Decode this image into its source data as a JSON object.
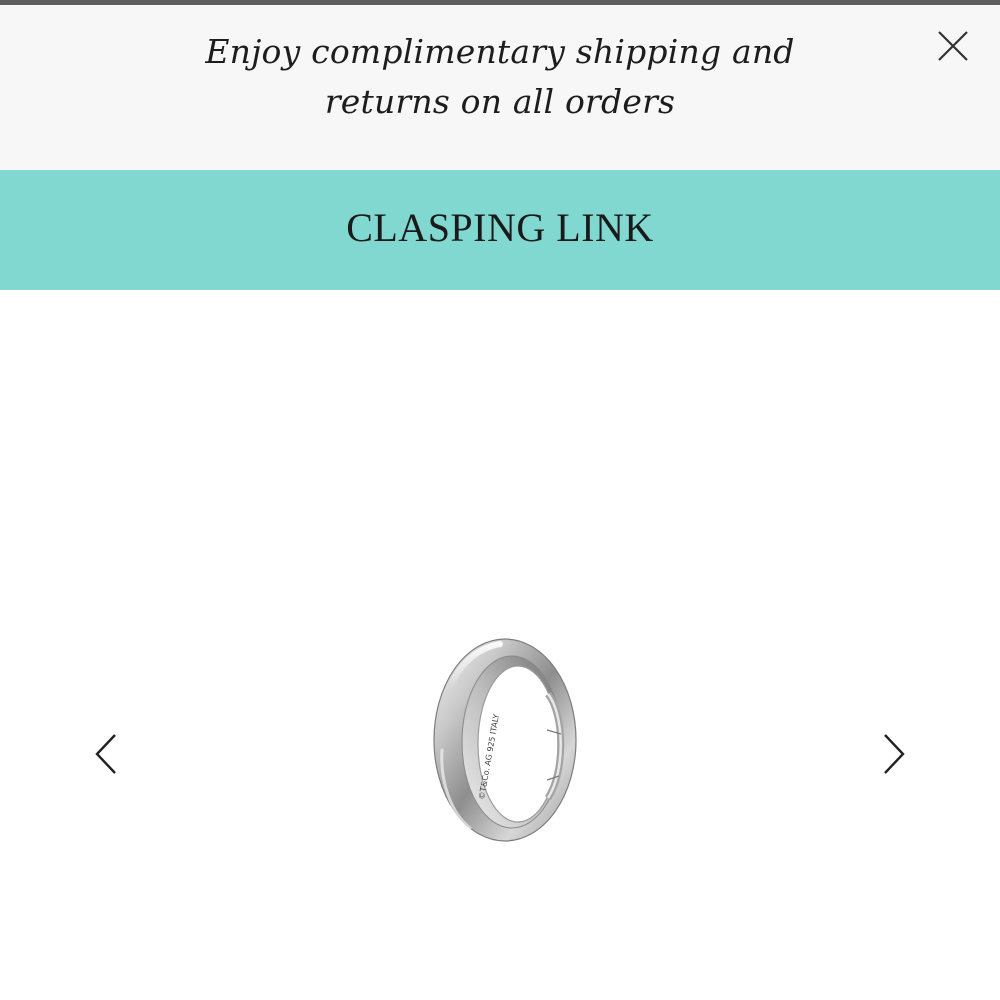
{
  "promo": {
    "line1": "Enjoy complimentary shipping and",
    "line2": "returns on all orders"
  },
  "header": {
    "title": "CLASPING LINK"
  },
  "carousel": {
    "prev_icon": "chevron-left-icon",
    "next_icon": "chevron-right-icon",
    "product_image": "clasping-link-silver-ring",
    "engraving": "©T&Co. AG 925 ITALY"
  },
  "colors": {
    "top_rule": "#5e5e5e",
    "promo_background": "#f7f7f7",
    "title_bar": "#81d8d0",
    "text": "#1a1a1a"
  },
  "icons": {
    "close": "close-icon"
  }
}
